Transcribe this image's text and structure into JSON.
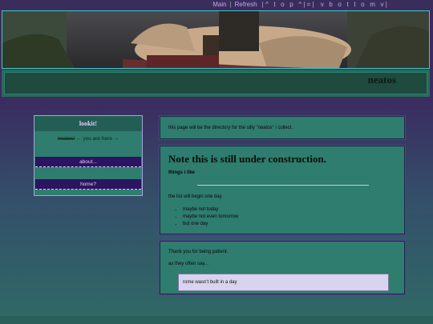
{
  "nav": {
    "main": "Main",
    "divider": "|",
    "refresh": "Refresh",
    "top": "|^ t o p ^|=|",
    "bottom": "v b o t t o m v|"
  },
  "banner": {
    "image": "horse-rider-banner"
  },
  "header": {
    "title": "neatos"
  },
  "sidebar": {
    "heading": "lookit!",
    "current_page": "neatos!",
    "current_suffix": "← you are here →",
    "links": [
      "about...",
      "home?"
    ]
  },
  "intro": {
    "text": "this page will be the directory for the silly \"neatos\" i collect."
  },
  "notice": {
    "heading": "Note this is still under construction.",
    "subheading": "things i like",
    "list_intro": "the list will begin one day",
    "items": [
      "maybe not today",
      "maybe not even tomorrow",
      "but one day"
    ]
  },
  "footer_panel": {
    "thanks": "Thank you for being patient.",
    "saying_intro": "as they often say...",
    "quote": "rome wasn't built in a day"
  },
  "colors": {
    "panel": "#2e7d6e",
    "button": "#2b1460",
    "accent": "#c9a3f0",
    "banner_border": "#3ec9c9"
  }
}
